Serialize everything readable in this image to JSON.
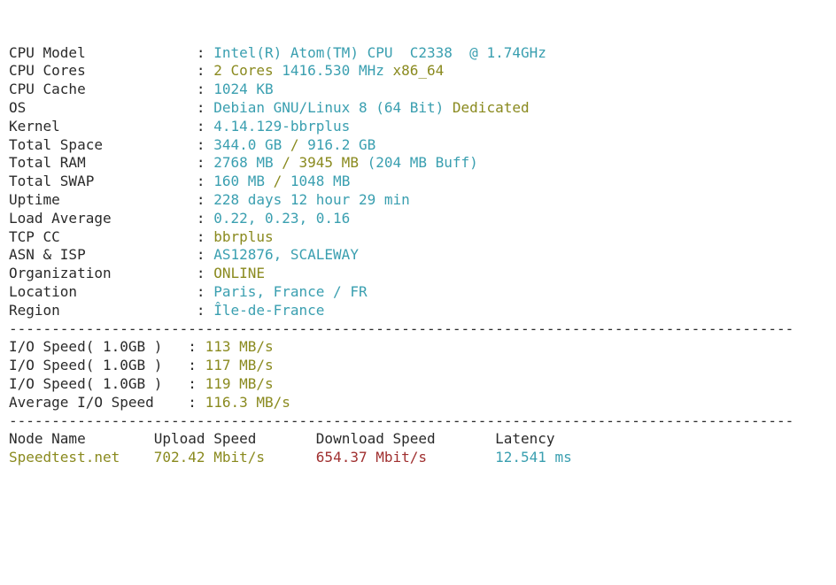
{
  "label_width": 22,
  "labels": {
    "cpu_model": "CPU Model",
    "cpu_cores": "CPU Cores",
    "cpu_cache": "CPU Cache",
    "os": "OS",
    "kernel": "Kernel",
    "total_space": "Total Space",
    "total_ram": "Total RAM",
    "total_swap": "Total SWAP",
    "uptime": "Uptime",
    "load_avg": "Load Average",
    "tcp_cc": "TCP CC",
    "asn_isp": "ASN & ISP",
    "org": "Organization",
    "location": "Location",
    "region": "Region",
    "io1": "I/O Speed( 1.0GB )",
    "io2": "I/O Speed( 1.0GB )",
    "io3": "I/O Speed( 1.0GB )",
    "io_avg": "Average I/O Speed"
  },
  "values": {
    "cpu_model": "Intel(R) Atom(TM) CPU  C2338  @ 1.74GHz",
    "cpu_cores_count": "2 Cores",
    "cpu_cores_freq": "1416.530 MHz",
    "cpu_cores_arch": "x86_64",
    "cpu_cache": "1024 KB",
    "os_name": "Debian GNU/Linux 8 (64 Bit)",
    "os_type": "Dedicated",
    "kernel": "4.14.129-bbrplus",
    "space_used": "344.0 GB",
    "space_total": "916.2 GB",
    "ram_used": "2768 MB",
    "ram_total": "3945 MB",
    "ram_buff": "(204 MB Buff)",
    "swap_used": "160 MB",
    "swap_total": "1048 MB",
    "uptime": "228 days 12 hour 29 min",
    "load_avg": "0.22, 0.23, 0.16",
    "tcp_cc": "bbrplus",
    "asn_isp": "AS12876, SCALEWAY",
    "org": "ONLINE",
    "location": "Paris, France / FR",
    "region": "Île-de-France",
    "io1": "113 MB/s",
    "io2": "117 MB/s",
    "io3": "119 MB/s",
    "io_avg": "116.3 MB/s"
  },
  "separator_char": "-",
  "separator_width": 92,
  "speedtest": {
    "headers": {
      "node": "Node Name",
      "upload": "Upload Speed",
      "download": "Download Speed",
      "latency": "Latency"
    },
    "col_widths": {
      "node": 17,
      "upload": 19,
      "download": 21
    },
    "rows": [
      {
        "node": "Speedtest.net",
        "upload": "702.42 Mbit/s",
        "download": "654.37 Mbit/s",
        "latency": "12.541 ms"
      }
    ]
  }
}
